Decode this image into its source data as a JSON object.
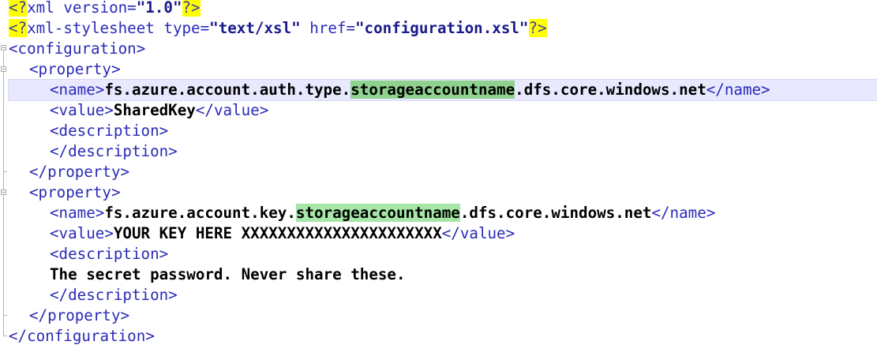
{
  "editor": {
    "lines": [
      {
        "pi_open": "<?",
        "text": "xml version=",
        "value": "\"1.0\"",
        "pi_close": "?>"
      },
      {
        "pi_open": "<?",
        "text": "xml-stylesheet type=",
        "value": "\"text/xsl\"",
        "text2": " href=",
        "value2": "\"configuration.xsl\"",
        "pi_close": "?>"
      },
      {
        "tag": "<configuration>"
      },
      {
        "tag": "<property>"
      },
      {
        "tag_open": "<name>",
        "text_pre": "fs.azure.account.auth.type.",
        "highlight": "storageaccountname",
        "text_post": ".dfs.core.windows.net",
        "tag_close": "</name>"
      },
      {
        "tag_open": "<value>",
        "text": "SharedKey",
        "tag_close": "</value>"
      },
      {
        "tag": "<description>"
      },
      {
        "tag": "</description>"
      },
      {
        "tag": "</property>"
      },
      {
        "tag": "<property>"
      },
      {
        "tag_open": "<name>",
        "text_pre": "fs.azure.account.key.",
        "highlight": "storageaccountname",
        "text_post": ".dfs.core.windows.net",
        "tag_close": "</name>"
      },
      {
        "tag_open": "<value>",
        "text": "YOUR KEY HERE XXXXXXXXXXXXXXXXXXXXXX",
        "tag_close": "</value>"
      },
      {
        "tag": "<description>"
      },
      {
        "text": "The secret password. Never share these."
      },
      {
        "tag": "</description>"
      },
      {
        "tag": "</property>"
      },
      {
        "tag": "</configuration>"
      }
    ]
  },
  "colors": {
    "tag": "#2a2ab8",
    "string": "#1a1a8c",
    "pi_highlight": "#ffff00",
    "match_highlight": "#8fd18f",
    "current_line": "#e8e8ff"
  }
}
